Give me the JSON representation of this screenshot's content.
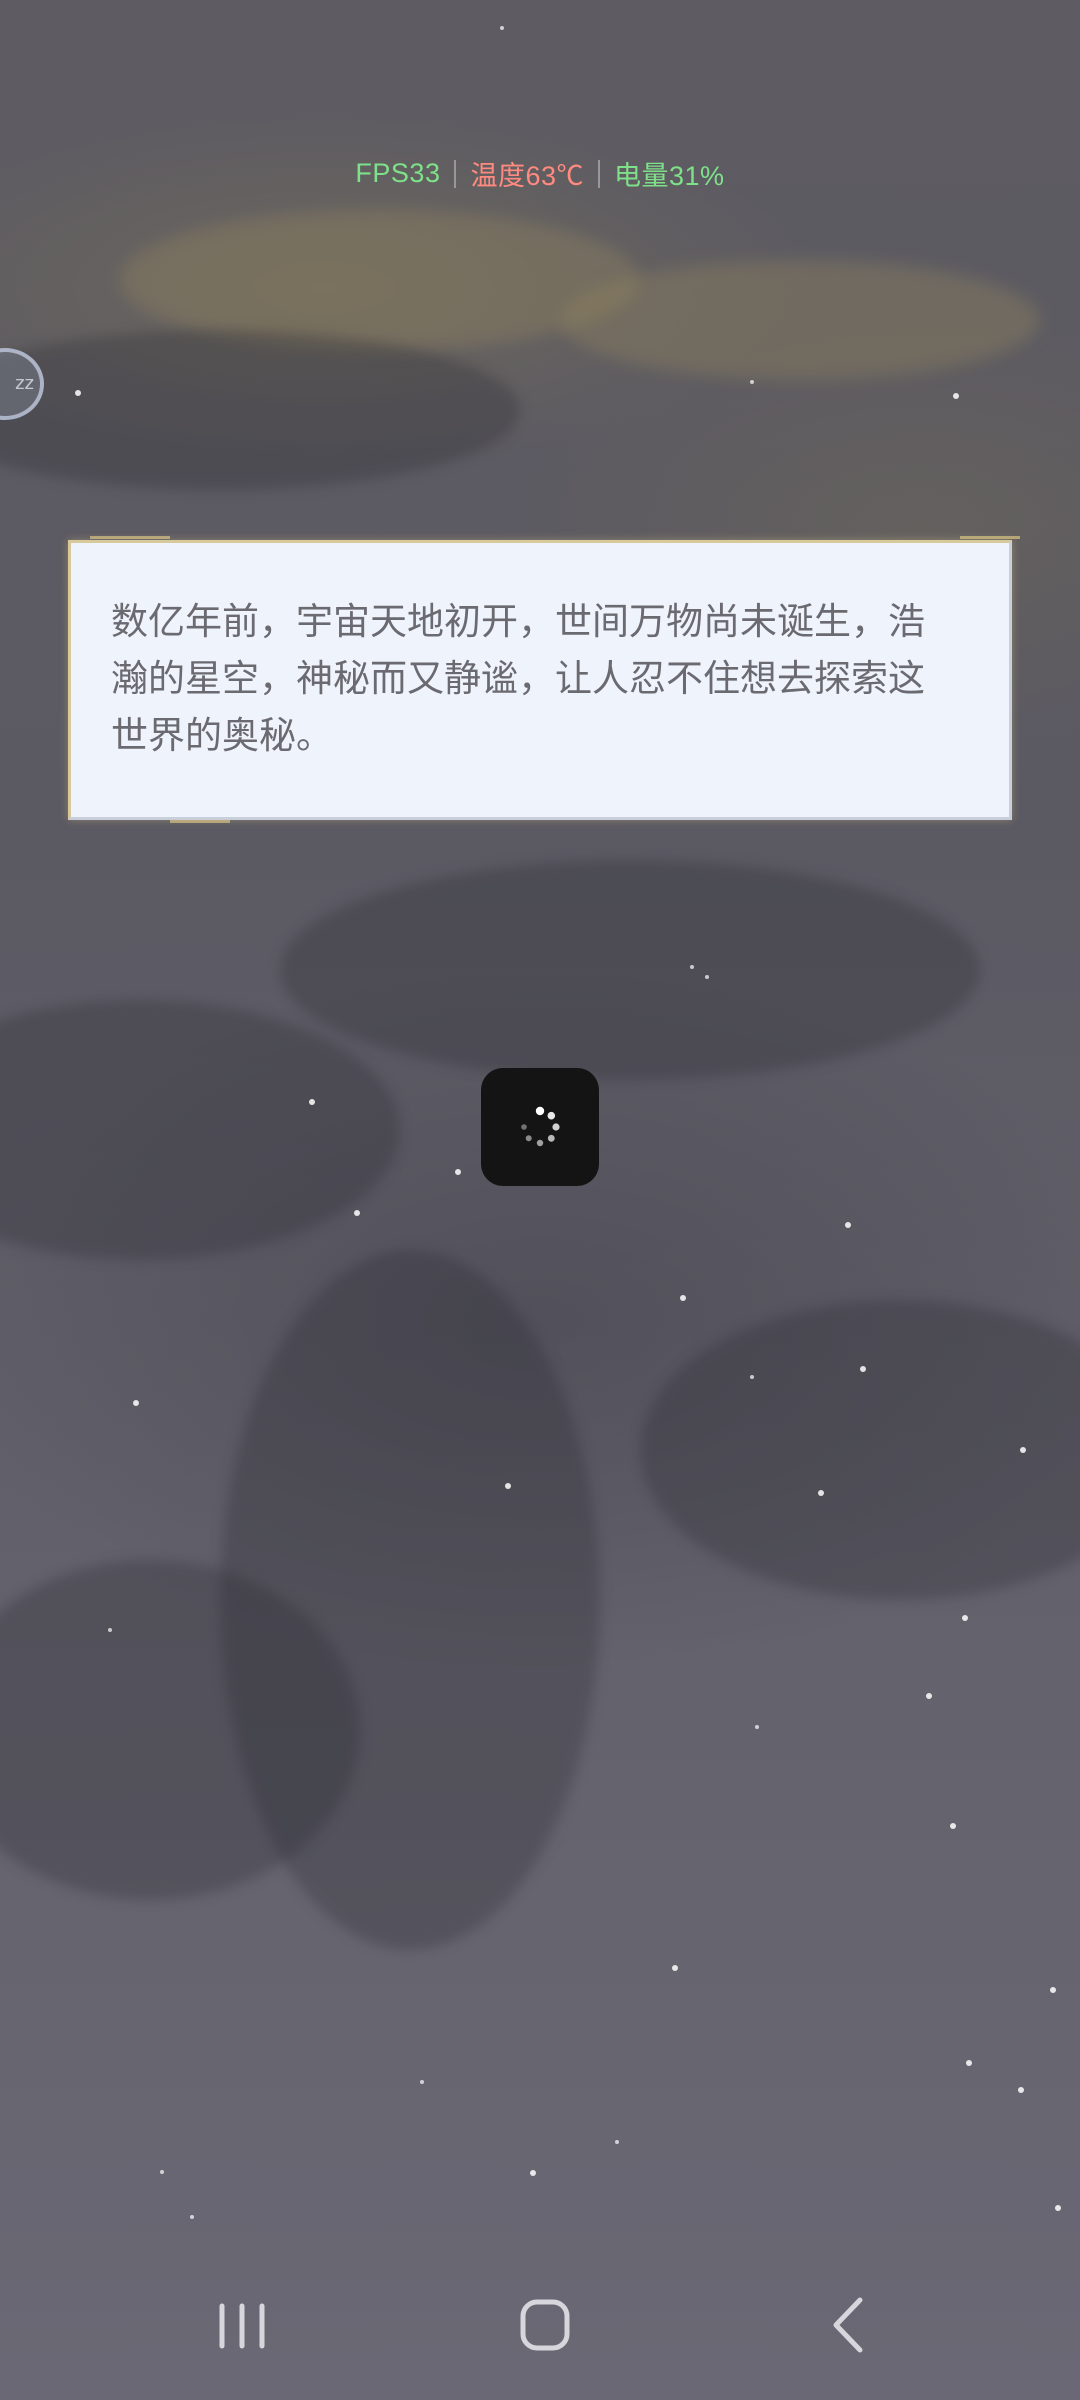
{
  "hud": {
    "fps": "FPS33",
    "temperature": "温度63℃",
    "battery": "电量31%",
    "colors": {
      "fps": "#7fe08a",
      "temperature": "#ff8a80",
      "battery": "#7fe08a"
    }
  },
  "floating_ball": {
    "label": "zz"
  },
  "story": {
    "text": "数亿年前，宇宙天地初开，世间万物尚未诞生，浩瀚的星空，神秘而又静谧，让人忍不住想去探索这世界的奥秘。"
  },
  "loading": {
    "icon": "spinner-icon"
  },
  "nav": {
    "recents_icon": "recents-icon",
    "home_icon": "home-icon",
    "back_icon": "back-icon"
  }
}
